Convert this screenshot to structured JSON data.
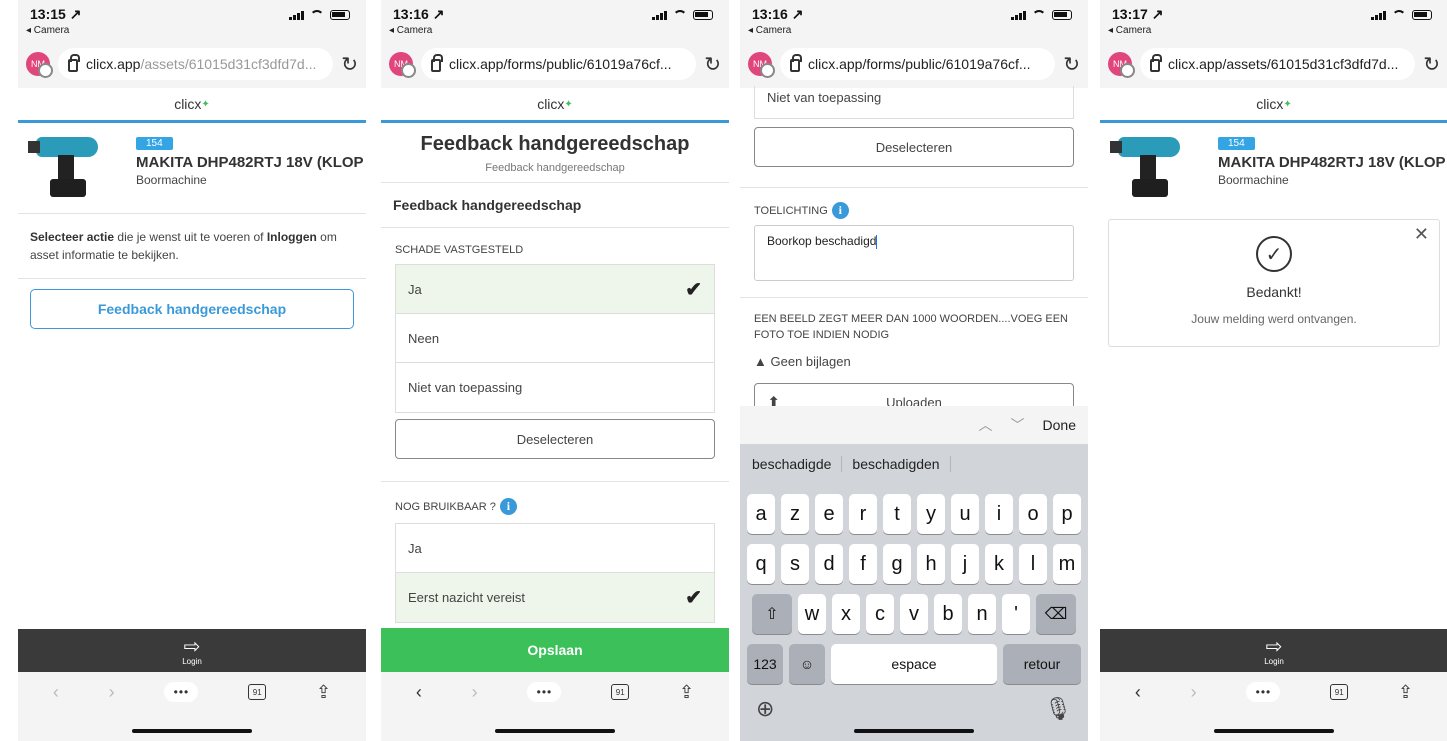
{
  "p1": {
    "time": "13:15 ↗",
    "back": "◂ Camera",
    "url_host": "clicx.app",
    "url_path": "/assets/61015d31cf3dfd7d...",
    "app_name": "clicx",
    "asset_badge": "154",
    "asset_name": "MAKITA DHP482RTJ 18V (KLOP",
    "asset_type": "Boormachine",
    "note_bold1": "Selecteer actie",
    "note_mid": " die je wenst uit te voeren of ",
    "note_bold2": "Inloggen",
    "note_tail": " om asset informatie te bekijken.",
    "action_button": "Feedback handgereedschap",
    "login_label": "Login",
    "tabs_count": "91"
  },
  "p2": {
    "time": "13:16 ↗",
    "back": "◂ Camera",
    "url": "clicx.app/forms/public/61019a76cf...",
    "app_name": "clicx",
    "form_title": "Feedback handgereedschap",
    "form_subtitle": "Feedback handgereedschap",
    "section": "Feedback handgereedschap",
    "q1": "SCHADE VASTGESTELD",
    "q1_options": [
      "Ja",
      "Neen",
      "Niet van toepassing"
    ],
    "deselect": "Deselecteren",
    "q2": "NOG BRUIKBAAR ?",
    "q2_options": [
      "Ja",
      "Eerst nazicht vereist"
    ],
    "save": "Opslaan",
    "tabs_count": "91"
  },
  "p3": {
    "time": "13:16 ↗",
    "back": "◂ Camera",
    "url": "clicx.app/forms/public/61019a76cf...",
    "prev_option": "Niet van toepassing",
    "deselect": "Deselecteren",
    "toelichting_label": "TOELICHTING",
    "toelichting_value": "Boorkop beschadigd",
    "photo_label": "EEN BEELD ZEGT MEER DAN 1000 WOORDEN....VOEG EEN FOTO TOE INDIEN NODIG",
    "no_attachments": "Geen bijlagen",
    "upload": "Uploaden",
    "done": "Done",
    "suggestions": [
      "beschadigde",
      "beschadigden"
    ],
    "row1": [
      "a",
      "z",
      "e",
      "r",
      "t",
      "y",
      "u",
      "i",
      "o",
      "p"
    ],
    "row2": [
      "q",
      "s",
      "d",
      "f",
      "g",
      "h",
      "j",
      "k",
      "l",
      "m"
    ],
    "row3": [
      "w",
      "x",
      "c",
      "v",
      "b",
      "n",
      "'"
    ],
    "num_key": "123",
    "space_key": "espace",
    "return_key": "retour"
  },
  "p4": {
    "time": "13:17 ↗",
    "back": "◂ Camera",
    "url": "clicx.app/assets/61015d31cf3dfd7d...",
    "app_name": "clicx",
    "asset_badge": "154",
    "asset_name": "MAKITA DHP482RTJ 18V (KLOP",
    "asset_type": "Boormachine",
    "thanks_title": "Bedankt!",
    "thanks_text": "Jouw melding werd ontvangen.",
    "login_label": "Login",
    "tabs_count": "91"
  },
  "avatar_initials": "NM",
  "colors": {
    "accent": "#3a9ad9",
    "save_green": "#3cc05a",
    "selected_bg": "#eef5ea",
    "badge": "#33a4e4"
  }
}
